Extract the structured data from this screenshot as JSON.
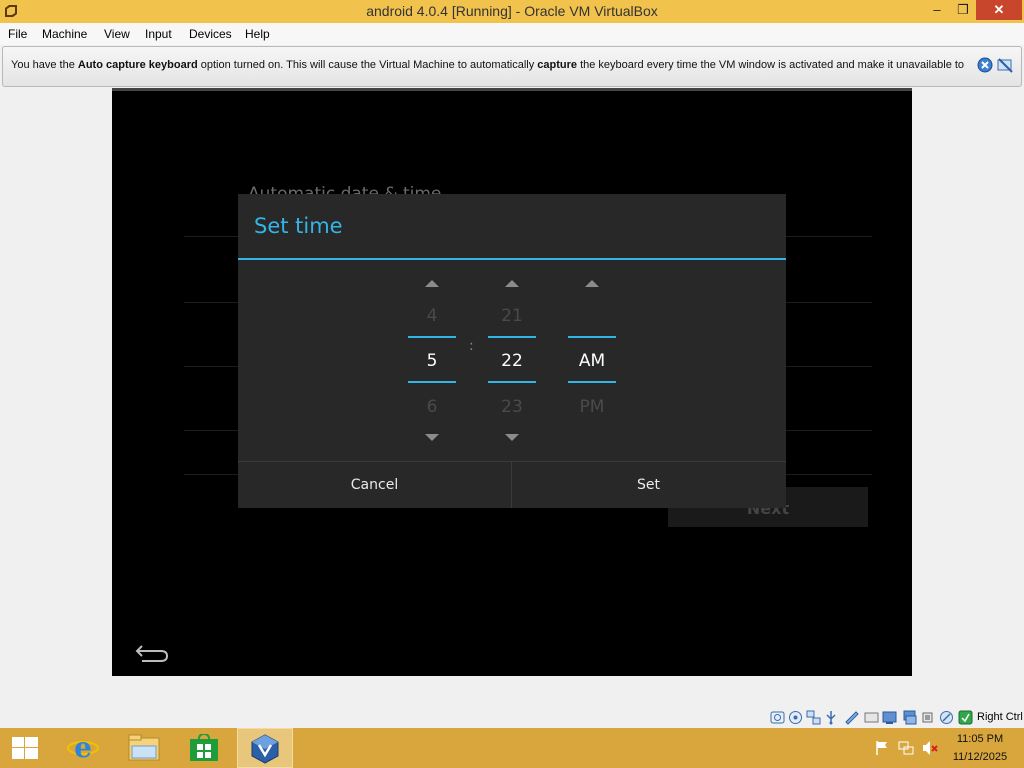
{
  "window": {
    "title": "android 4.0.4 [Running] - Oracle VM VirtualBox",
    "minimize_glyph": "–",
    "maximize_glyph": "❐",
    "close_glyph": "✕"
  },
  "menu": {
    "items": [
      "File",
      "Machine",
      "View",
      "Input",
      "Devices",
      "Help"
    ]
  },
  "notice": {
    "part1": "You have the ",
    "bold1": "Auto capture keyboard",
    "part2": " option turned on. This will cause the Virtual Machine to automatically ",
    "bold2": "capture",
    "part3": " the keyboard every time the VM window is activated and make it unavailable to"
  },
  "android": {
    "background_setting": "Automatic date & time",
    "background_next": "Next",
    "dialog": {
      "title": "Set time",
      "hour": {
        "prev": "4",
        "current": "5",
        "next": "6"
      },
      "separator": ":",
      "minute": {
        "prev": "21",
        "current": "22",
        "next": "23"
      },
      "ampm": {
        "current": "AM",
        "next": "PM"
      },
      "cancel_label": "Cancel",
      "set_label": "Set"
    }
  },
  "statusbar": {
    "host_key": "Right Ctrl"
  },
  "taskbar": {
    "time": "11:05 PM",
    "date": "11/12/2025"
  },
  "colors": {
    "accent": "#33b5e5",
    "titlebar": "#f1c34d",
    "taskbar": "#d9a63d",
    "close": "#c7462c"
  }
}
